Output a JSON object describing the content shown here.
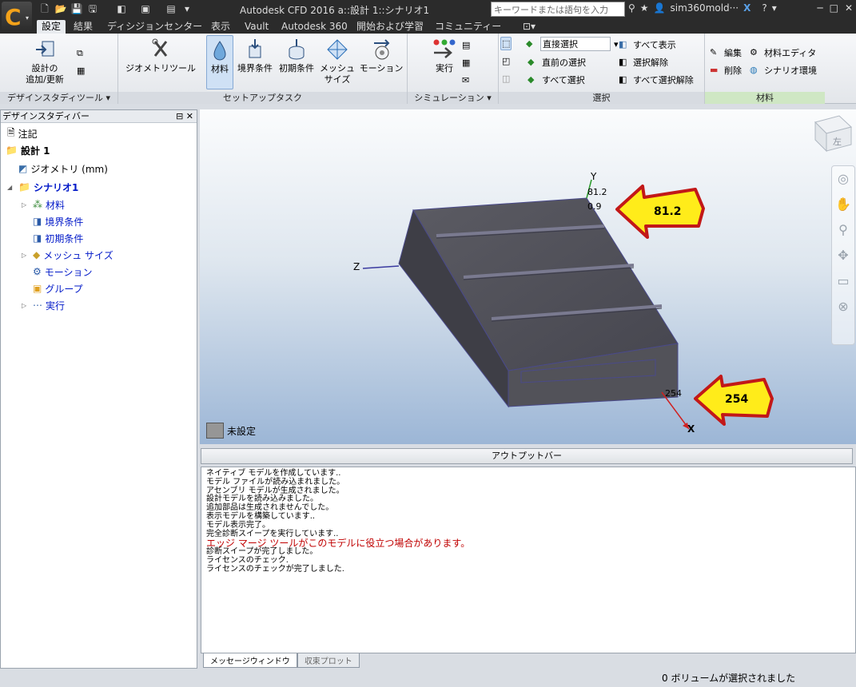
{
  "app": {
    "title": "Autodesk CFD 2016   a::設計 1::シナリオ1",
    "search_placeholder": "キーワードまたは語句を入力",
    "user": "sim360mold···",
    "accent": "#f3a21a"
  },
  "tabs": [
    "設定",
    "結果",
    "ディシジョンセンター",
    "表示",
    "Vault",
    "Autodesk 360",
    "開始および学習",
    "コミュニティー"
  ],
  "ribbon": {
    "design_tools": {
      "add_update": "設計の\n追加/更新",
      "panel_label": "デザインスタディツール ▾"
    },
    "setup": {
      "geometry_tools": "ジオメトリツール",
      "material": "材料",
      "boundary": "境界条件",
      "initial": "初期条件",
      "mesh": "メッシュ\nサイズ",
      "motion": "モーション",
      "panel_label": "セットアップタスク"
    },
    "simulation": {
      "run": "実行",
      "panel_label": "シミュレーション ▾"
    },
    "selection": {
      "dropdown": "直接選択",
      "prev": "直前の選択",
      "all": "すべて選択",
      "show_all": "すべて表示",
      "deselect": "選択解除",
      "deselect_all": "すべて選択解除",
      "panel_label": "選択"
    },
    "materials": {
      "edit": "編集",
      "delete": "削除",
      "editor": "材料エディタ",
      "env": "シナリオ環境",
      "panel_label": "材料"
    }
  },
  "sidebar": {
    "title": "デザインスタディバー",
    "tree": {
      "notes": "注記",
      "design": "設計 1",
      "geometry": "ジオメトリ (mm)",
      "scenario": "シナリオ1",
      "materials": "材料",
      "boundary": "境界条件",
      "initial": "初期条件",
      "mesh": "メッシュ サイズ",
      "motion": "モーション",
      "group": "グループ",
      "run": "実行"
    }
  },
  "viewport": {
    "axis_y": "Y",
    "axis_z": "Z",
    "axis_x": "X",
    "y_ticks": [
      "81.2",
      "0.9"
    ],
    "x_tick": "254",
    "callout_top": "81.2",
    "callout_bottom": "254",
    "legend_label": "未設定",
    "cube_label": "左"
  },
  "output": {
    "header": "アウトプットバー",
    "lines": [
      "ネイティブ モデルを作成しています..",
      "モデル ファイルが読み込まれました。",
      "アセンブリ モデルが生成されました。",
      "設計モデルを読み込みました。",
      "追加部品は生成されませんでした。",
      "表示モデルを構築しています..",
      "モデル表示完了。",
      "完全診断スイープを実行しています..",
      "エッジ マージ ツールがこのモデルに役立つ場合があります。",
      "診断スイープが完了しました。",
      "ライセンスのチェック.",
      "ライセンスのチェックが完了しました."
    ],
    "warning_color": "#c00000",
    "tabs": [
      "メッセージウィンドウ",
      "収束プロット"
    ]
  },
  "status": "0 ボリュームが選択されました"
}
